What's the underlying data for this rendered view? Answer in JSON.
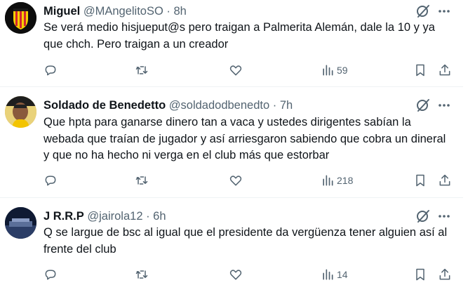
{
  "tweets": [
    {
      "name": "Miguel",
      "handle": "@MAngelitoSO",
      "time": "· 8h",
      "text": "Se verá medio hisjueput@s pero traigan a Palmerita Alemán, dale la 10 y ya que chch. Pero traigan a un creador",
      "views": "59"
    },
    {
      "name": "Soldado de Benedetto",
      "handle": "@soldadodbenedto",
      "time": "· 7h",
      "text": "Que hpta para ganarse dinero tan a vaca y ustedes dirigentes sabían la webada que traían de jugador y así arriesgaron sabiendo que cobra un dineral y que no ha hecho ni verga en el club más que estorbar",
      "views": "218"
    },
    {
      "name": "J R.R.P",
      "handle": "@jairola12",
      "time": "· 6h",
      "text": "Q se largue  de bsc al igual que el presidente  da vergüenza tener alguien así al frente del club",
      "views": "14"
    }
  ],
  "icons": {
    "reply": "reply-icon",
    "retweet": "retweet-icon",
    "like": "like-icon",
    "views": "views-icon",
    "bookmark": "bookmark-icon",
    "share": "share-icon",
    "grok": "grok-icon",
    "more": "more-icon"
  },
  "colors": {
    "text": "#0f1419",
    "secondary": "#536471",
    "divider": "#eff3f4",
    "club_yellow": "#f5d000",
    "club_red": "#d22630"
  }
}
